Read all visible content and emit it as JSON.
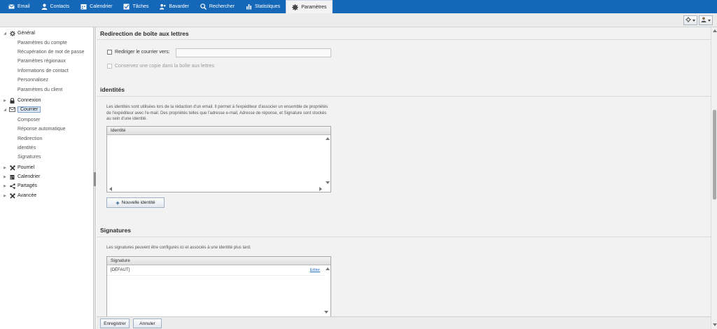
{
  "nav": {
    "tabs": [
      {
        "label": "Email",
        "icon": "envelope-icon"
      },
      {
        "label": "Contacts",
        "icon": "person-icon"
      },
      {
        "label": "Calendrier",
        "icon": "calendar-icon"
      },
      {
        "label": "Tâches",
        "icon": "checkbox-icon"
      },
      {
        "label": "Bavarder",
        "icon": "chat-icon"
      },
      {
        "label": "Rechercher",
        "icon": "search-icon"
      },
      {
        "label": "Statistiques",
        "icon": "bar-chart-icon"
      },
      {
        "label": "Paramètres",
        "icon": "gear-icon"
      }
    ],
    "active_tab": "Paramètres",
    "accent_color": "#1568b8"
  },
  "sidebar": {
    "groups": [
      {
        "label": "Général",
        "icon": "gear-icon",
        "expanded": true,
        "children": [
          "Paramètres du compte",
          "Récupération de mot de passe",
          "Paramètres régionaux",
          "Informations de contact",
          "Personnalisez",
          "Paramètres du client"
        ]
      },
      {
        "label": "Connexion",
        "icon": "lock-icon",
        "expanded": false,
        "children": []
      },
      {
        "label": "Courrier",
        "icon": "envelope-icon",
        "expanded": true,
        "selected": true,
        "children": [
          "Composer",
          "Réponse automatique",
          "Redirection",
          "identités",
          "Signatures"
        ]
      },
      {
        "label": "Pourriel",
        "icon": "tools-icon",
        "expanded": false,
        "children": []
      },
      {
        "label": "Calendrier",
        "icon": "calendar-icon",
        "expanded": false,
        "children": []
      },
      {
        "label": "Partagés",
        "icon": "share-icon",
        "expanded": false,
        "children": []
      },
      {
        "label": "Avancée",
        "icon": "tools-icon",
        "expanded": false,
        "children": []
      }
    ]
  },
  "redirect": {
    "title": "Redirection de boîte aux lettres",
    "forward_label": "Rediriger le courrier vers:",
    "forward_value": "",
    "keep_copy_label": "Conservez une copie dans la boîte aux lettres"
  },
  "identities": {
    "title": "identités",
    "description": "Les identités sont utilisées lors de la rédaction d'un email. Il permet à l'expéditeur d'associer un ensemble de propriétés de l'expéditeur avec l'e-mail. Des propriétés telles que l'adresse e-mail, Adresse de réponse, et Signature sont stockés au sein d'une identité.",
    "column_header": "Identité",
    "rows": [],
    "new_button": "Nouvelle identité"
  },
  "signatures": {
    "title": "Signatures",
    "description": "Les signatures peuvent être configurés ici et associés à une identité plus tard.",
    "column_header": "Signature",
    "rows": [
      {
        "name": "[DÉFAUT]",
        "action": "Editer"
      }
    ]
  },
  "footer": {
    "save": "Enregistrer",
    "cancel": "Annuler"
  }
}
